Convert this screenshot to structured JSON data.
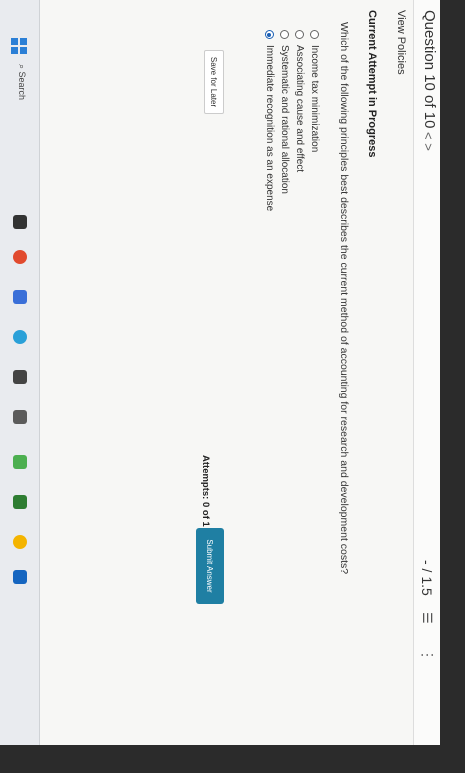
{
  "header": {
    "question_title": "Question 10 of 10",
    "nav": "< >",
    "score": "- / 1.5",
    "menu_glyph": "☰",
    "more_glyph": "⋮"
  },
  "view_policies": "View Policies",
  "attempt_title": "Current Attempt in Progress",
  "question": {
    "prompt": "Which of the following principles best describes the current method of accounting for research and development costs?",
    "options": [
      {
        "label": "Income tax minimization",
        "selected": false
      },
      {
        "label": "Associating cause and effect",
        "selected": false
      },
      {
        "label": "Systematic and rational allocation",
        "selected": false
      },
      {
        "label": "Immediate recognition as an expense",
        "selected": true
      }
    ]
  },
  "footer": {
    "save_label": "Save for Later",
    "attempts_label": "Attempts: 0 of 1 used",
    "submit_label": "Submit Answer"
  },
  "taskbar": {
    "search_label": "Search",
    "colors": {
      "accent": "#1f7fa3",
      "start": "#2b7fd6"
    }
  }
}
